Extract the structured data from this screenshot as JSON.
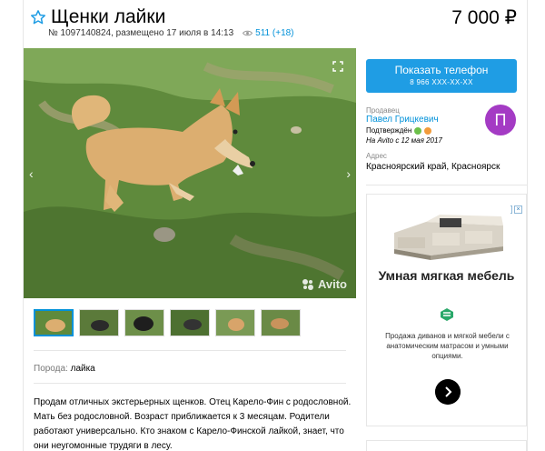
{
  "listing": {
    "title": "Щенки лайки",
    "price": "7 000 ₽",
    "meta": "№ 1097140824, размещено 17 июля в 14:13",
    "views": "511 (+18)"
  },
  "photo": {
    "watermark": "Avito",
    "thumbnail_count": 6
  },
  "details": {
    "breed_label": "Порода:",
    "breed_value": "лайка"
  },
  "description": "Продам отличных экстерьерных щенков. Отец Карело-Фин с родословной. Мать без родословной. Возраст приближается к 3 месяцам. Родители работают универсально. Кто знаком с Карело-Финской лайкой, знает, что они неугомонные трудяги в лесу.",
  "seller": {
    "phone_button": "Показать телефон",
    "phone_masked": "8 966 XXX-XX-XX",
    "label": "Продавец",
    "name": "Павел Грицкевич",
    "verified": "Подтверждён",
    "since": "На Avito с 12 мая 2017",
    "avatar_letter": "П",
    "address_label": "Адрес",
    "address": "Красноярский край, Красноярск"
  },
  "ad": {
    "headline": "Умная мягкая мебель",
    "text": "Продажа диванов и мягкой мебели с анатомическим матрасом и умными опциями."
  },
  "colors": {
    "accent": "#1f9de4",
    "link": "#0091d9",
    "avatar": "#a43bc4"
  },
  "icons": [
    "star-icon",
    "eye-icon",
    "expand-icon",
    "arrow-left-icon",
    "arrow-right-icon",
    "phone-check-icon",
    "coin-icon",
    "adchoices-icon",
    "close-icon",
    "arrow-right-circle-icon"
  ]
}
